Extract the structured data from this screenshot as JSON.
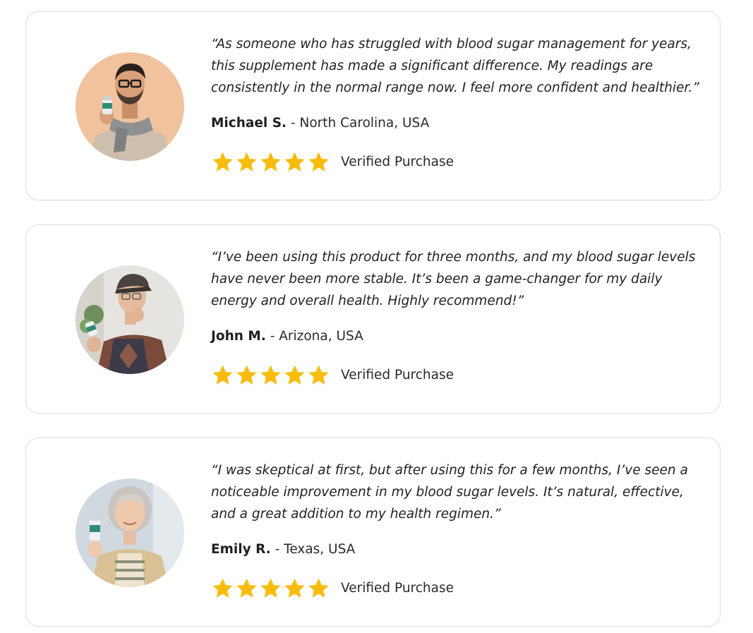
{
  "accent": {
    "star_color": "#f7bd0e",
    "card_border": "#dcdcdc"
  },
  "testimonials": [
    {
      "quote": "“As someone who has struggled with blood sugar management for years, this supplement has made a significant difference. My readings are consistently in the normal range now. I feel more confident and healthier.”",
      "name": "Michael S.",
      "location": " - North Carolina, USA",
      "rating": 5,
      "verified_label": "Verified Purchase",
      "avatar_icon": "man-with-glasses-and-scarf-holding-bottle"
    },
    {
      "quote": "“I’ve been using this product for three months, and my blood sugar levels have never been more stable. It’s been a game-changer for my daily energy and overall health. Highly recommend!”",
      "name": "John M.",
      "location": " - Arizona, USA",
      "rating": 5,
      "verified_label": "Verified Purchase",
      "avatar_icon": "elderly-man-with-cap-holding-bottle"
    },
    {
      "quote": "“I was skeptical at first, but after using this for a few months, I’ve seen a noticeable improvement in my blood sugar levels. It’s natural, effective, and a great addition to my health regimen.”",
      "name": "Emily R.",
      "location": " - Texas, USA",
      "rating": 5,
      "verified_label": "Verified Purchase",
      "avatar_icon": "elderly-woman-holding-bottle"
    }
  ]
}
